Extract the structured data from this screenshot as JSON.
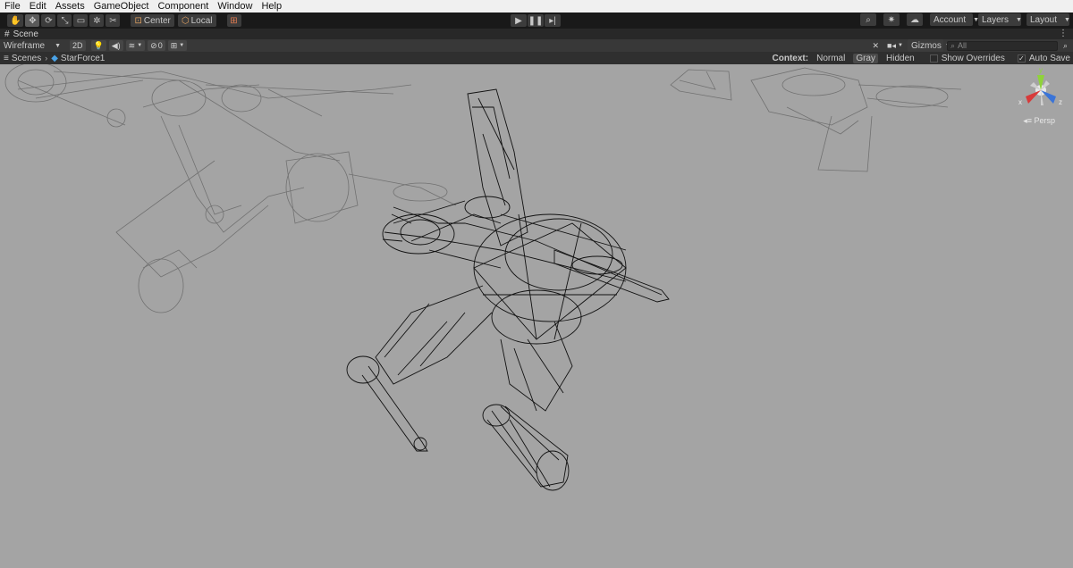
{
  "menu": [
    "File",
    "Edit",
    "Assets",
    "GameObject",
    "Component",
    "Window",
    "Help"
  ],
  "toolbar": {
    "tools": [
      {
        "name": "hand-tool-icon",
        "glyph": "✋"
      },
      {
        "name": "move-tool-icon",
        "glyph": "✥"
      },
      {
        "name": "rotate-tool-icon",
        "glyph": "⟳"
      },
      {
        "name": "scale-tool-icon",
        "glyph": "⤡"
      },
      {
        "name": "rect-tool-icon",
        "glyph": "▭"
      },
      {
        "name": "transform-tool-icon",
        "glyph": "✲"
      },
      {
        "name": "custom-tool-icon",
        "glyph": "✂"
      }
    ],
    "pivot_label": "Center",
    "space_label": "Local",
    "account_label": "Account",
    "layers_label": "Layers",
    "layout_label": "Layout"
  },
  "scene_tab": {
    "label": "Scene"
  },
  "scene_toolbar": {
    "draw_mode": "Wireframe",
    "mode_2d": "2D",
    "hidden_count": "0",
    "gizmos_label": "Gizmos",
    "search_placeholder": "All"
  },
  "breadcrumb": {
    "root": "Scenes",
    "current": "StarForce1"
  },
  "context": {
    "label": "Context:",
    "options": [
      "Normal",
      "Gray",
      "Hidden"
    ],
    "show_overrides": "Show Overrides",
    "auto_save": "Auto Save"
  },
  "gizmo": {
    "projection": "Persp",
    "axes": [
      "y",
      "x",
      "z"
    ],
    "colors": {
      "x": "#d83a3a",
      "y": "#8fd33a",
      "z": "#3a74d8"
    }
  },
  "colors": {
    "viewport_bg": "#a4a4a4",
    "menubar_bg": "#f0f0f0",
    "toolbar_bg": "#191919",
    "wire_main": "#111111",
    "wire_ghost": "#6c6c6c"
  }
}
